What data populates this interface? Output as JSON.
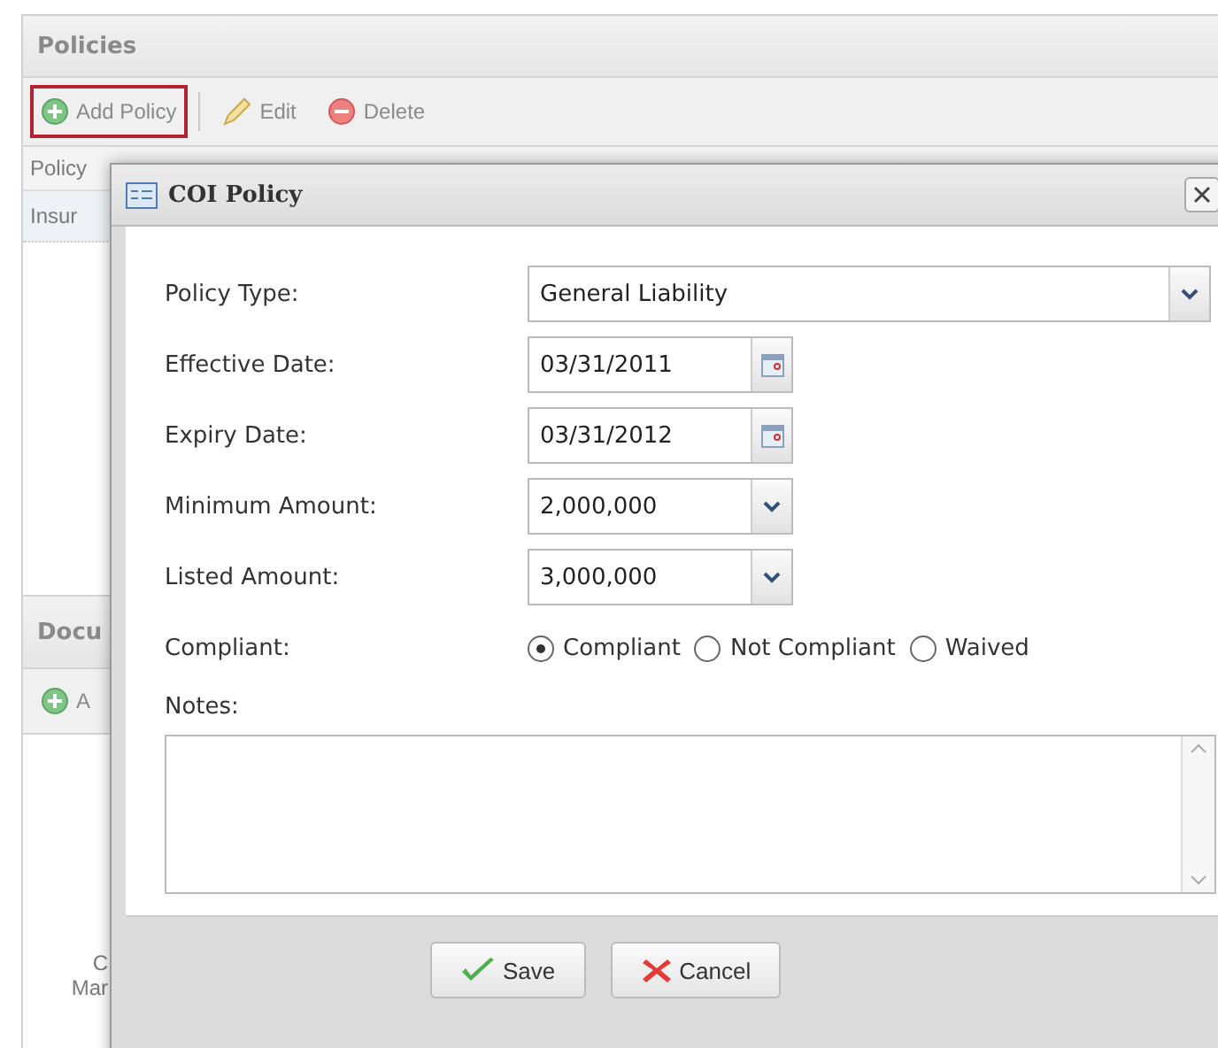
{
  "policies_panel": {
    "title": "Policies",
    "toolbar": [
      {
        "kind": "add",
        "label": "Add Policy",
        "highlighted": true
      },
      {
        "kind": "edit",
        "label": "Edit",
        "highlighted": false
      },
      {
        "kind": "delete",
        "label": "Delete",
        "highlighted": false
      }
    ],
    "grid_header": "Policy",
    "grid_row": "Insur"
  },
  "documents_panel": {
    "title": "Docu",
    "toolbar_label": "A",
    "cell_lines": [
      "C",
      "Mar"
    ]
  },
  "dialog": {
    "title": "COI Policy",
    "fields": [
      {
        "kind": "select",
        "label": "Policy Type:",
        "value": "General Liability",
        "wide": true
      },
      {
        "kind": "date",
        "label": "Effective Date:",
        "value": "03/31/2011"
      },
      {
        "kind": "date",
        "label": "Expiry Date:",
        "value": "03/31/2012"
      },
      {
        "kind": "select",
        "label": "Minimum Amount:",
        "value": "2,000,000",
        "wide": false
      },
      {
        "kind": "select",
        "label": "Listed Amount:",
        "value": "3,000,000",
        "wide": false
      },
      {
        "kind": "radio",
        "label": "Compliant:",
        "options": [
          {
            "label": "Compliant",
            "selected": true
          },
          {
            "label": "Not Compliant",
            "selected": false
          },
          {
            "label": "Waived",
            "selected": false
          }
        ]
      }
    ],
    "notes_label": "Notes:",
    "buttons": [
      {
        "kind": "save",
        "label": "Save"
      },
      {
        "kind": "cancel",
        "label": "Cancel"
      }
    ]
  }
}
